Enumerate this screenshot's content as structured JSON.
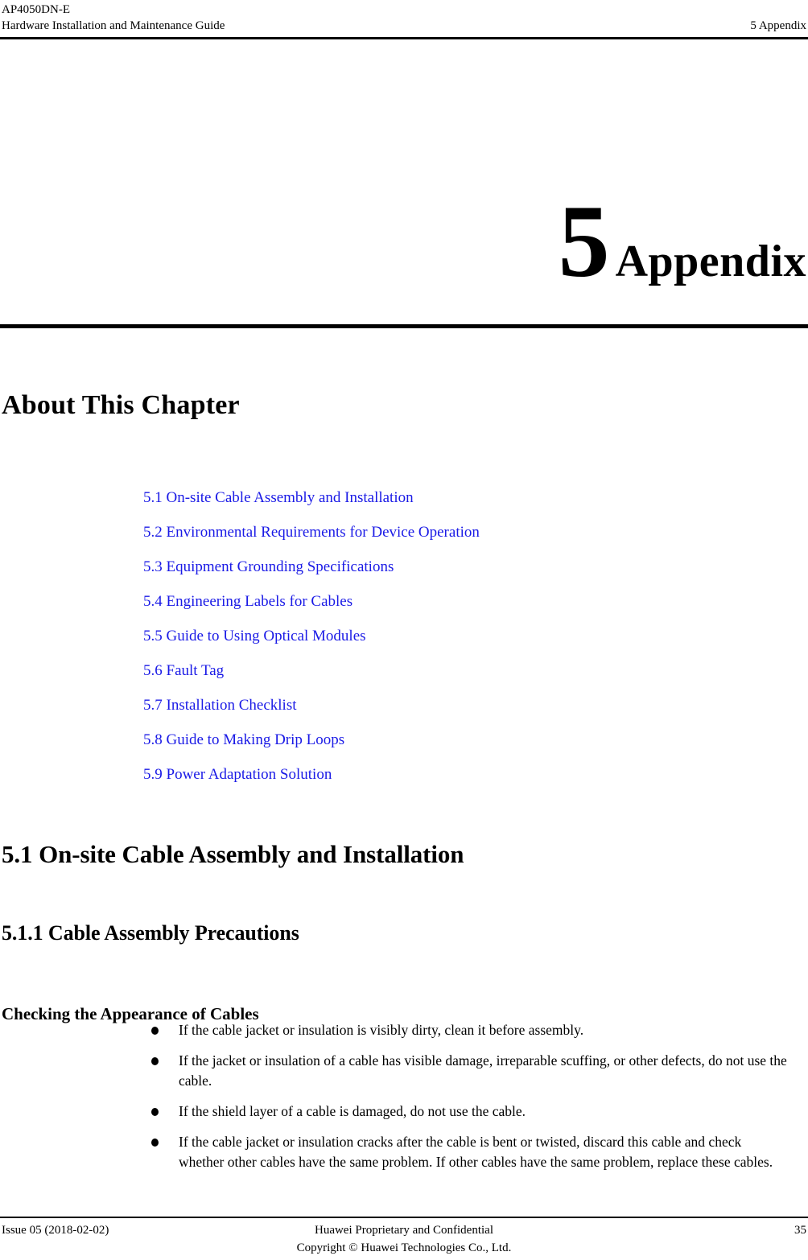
{
  "header": {
    "product_line": "AP4050DN-E",
    "guide_title": "Hardware Installation and Maintenance Guide",
    "chapter_ref": "5 Appendix"
  },
  "chapter": {
    "number": "5",
    "title": "Appendix"
  },
  "about": {
    "heading": "About This Chapter"
  },
  "toc": {
    "entries": [
      {
        "label": "5.1 On-site Cable Assembly and Installation"
      },
      {
        "label": "5.2 Environmental Requirements for Device Operation"
      },
      {
        "label": "5.3 Equipment Grounding Specifications"
      },
      {
        "label": "5.4 Engineering Labels for Cables"
      },
      {
        "label": "5.5 Guide to Using Optical Modules"
      },
      {
        "label": "5.6 Fault Tag"
      },
      {
        "label": "5.7 Installation Checklist"
      },
      {
        "label": "5.8 Guide to Making Drip Loops"
      },
      {
        "label": "5.9 Power Adaptation Solution"
      }
    ],
    "link_color": "#1a1ae6"
  },
  "sections": {
    "h1": "5.1 On-site Cable Assembly and Installation",
    "h2": "5.1.1 Cable Assembly Precautions",
    "h3": "Checking the Appearance of Cables"
  },
  "bullets": [
    "If the cable jacket or insulation is visibly dirty, clean it before assembly.",
    "If the jacket or insulation of a cable has visible damage, irreparable scuffing, or other defects, do not use the cable.",
    "If the shield layer of a cable is damaged, do not use the cable.",
    "If the cable jacket or insulation cracks after the cable is bent or twisted, discard this cable and check whether other cables have the same problem. If other cables have the same problem, replace these cables."
  ],
  "footer": {
    "issue": "Issue 05 (2018-02-02)",
    "confidentiality": "Huawei Proprietary and Confidential",
    "copyright": "Copyright © Huawei Technologies Co., Ltd.",
    "page_number": "35"
  }
}
